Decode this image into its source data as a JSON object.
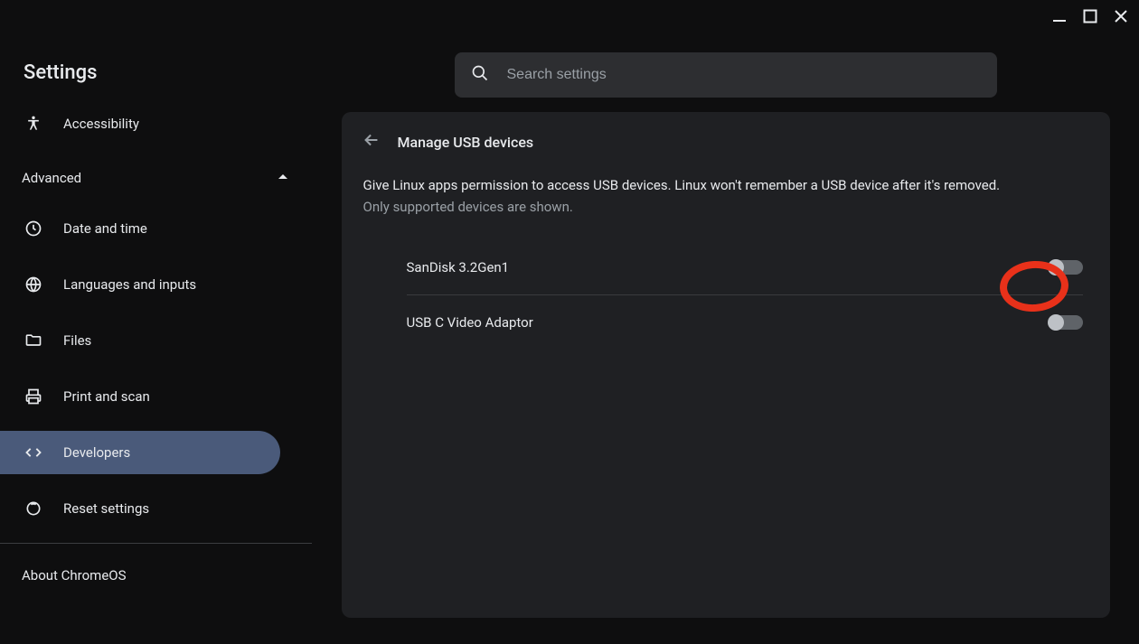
{
  "app_title": "Settings",
  "search": {
    "placeholder": "Search settings"
  },
  "sidebar": {
    "top": [
      {
        "id": "accessibility",
        "label": "Accessibility"
      }
    ],
    "section_label": "Advanced",
    "items": [
      {
        "id": "datetime",
        "label": "Date and time"
      },
      {
        "id": "languages",
        "label": "Languages and inputs"
      },
      {
        "id": "files",
        "label": "Files"
      },
      {
        "id": "printscan",
        "label": "Print and scan"
      },
      {
        "id": "developers",
        "label": "Developers"
      },
      {
        "id": "reset",
        "label": "Reset settings"
      }
    ],
    "about_label": "About ChromeOS"
  },
  "panel": {
    "title": "Manage USB devices",
    "description_primary": "Give Linux apps permission to access USB devices. Linux won't remember a USB device after it's removed.",
    "description_secondary": "Only supported devices are shown."
  },
  "devices": [
    {
      "name": "SanDisk 3.2Gen1",
      "enabled": false
    },
    {
      "name": "USB C Video Adaptor",
      "enabled": false
    }
  ]
}
